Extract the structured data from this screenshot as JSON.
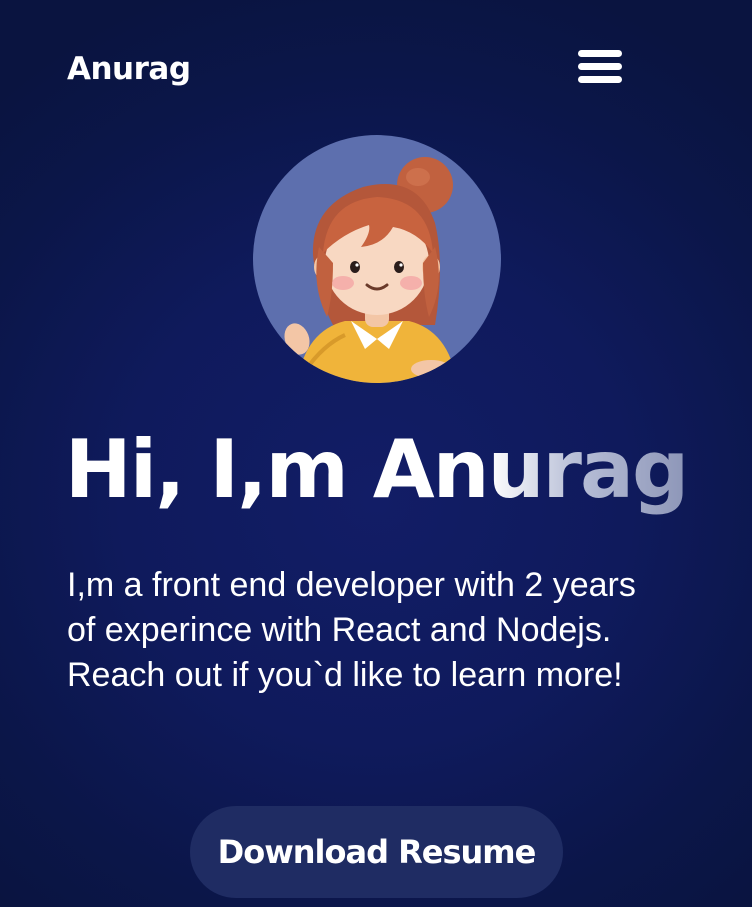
{
  "nav": {
    "brand": "Anurag",
    "menu_icon": "hamburger-menu-icon"
  },
  "hero": {
    "avatar_icon": "cartoon-girl-avatar",
    "title": "Hi, I,m Anurag",
    "bio": "I,m a front end developer with 2 years of experince with React and Nodejs. Reach out if you`d like to learn more!",
    "resume_label": "Download Resume"
  },
  "colors": {
    "background": "#0f1a5c",
    "avatar_bg": "#5d6fae",
    "button_bg": "#1f2c63",
    "text": "#ffffff"
  }
}
